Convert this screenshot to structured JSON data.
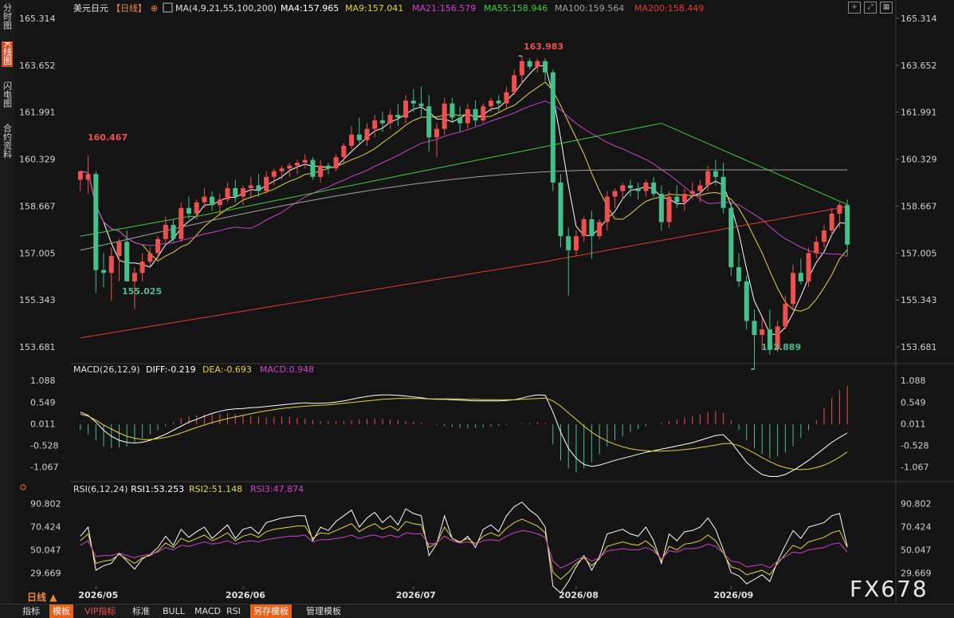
{
  "leftbar": {
    "tabs": [
      {
        "label": "分时图",
        "active": false
      },
      {
        "label": "K线图",
        "active": true
      },
      {
        "label": "闪电图",
        "active": false
      },
      {
        "label": "合约资料",
        "active": false
      }
    ]
  },
  "header": {
    "symbol": "美元日元",
    "period": "【日线】",
    "ma_title": "MA(4,9,21,55,100,200)",
    "ma4": "MA4:157.965",
    "ma9": "MA9:157.041",
    "ma21": "MA21:156.579",
    "ma55": "MA55:158.946",
    "ma100": "MA100:159.564",
    "ma200": "MA200:158.449"
  },
  "macd_header": {
    "title": "MACD(26,12,9)",
    "diff": "DIFF:-0.219",
    "dea": "DEA:-0.693",
    "macd": "MACD:0.948"
  },
  "rsi_header": {
    "title": "RSI(6,12,24)",
    "rsi1": "RSI1:53.253",
    "rsi2": "RSI2:51.148",
    "rsi3": "RSI3:47.874"
  },
  "price_axis": [
    "165.314",
    "163.652",
    "161.991",
    "160.329",
    "158.667",
    "157.005",
    "155.343",
    "153.681"
  ],
  "macd_axis": [
    "1.088",
    "0.549",
    "0.011",
    "-0.528",
    "-1.067"
  ],
  "rsi_axis": [
    "90.802",
    "70.424",
    "50.047",
    "29.669"
  ],
  "date_labels": [
    "2026/05",
    "2026/06",
    "2026/07",
    "2026/08",
    "2026/09"
  ],
  "annotations": {
    "high": "163.983",
    "first_high": "160.467",
    "first_low": "155.025",
    "low": "152.889"
  },
  "watermark": "FX678",
  "bottom_tabs": [
    {
      "label": "指标",
      "active": false
    },
    {
      "label": "模板",
      "active": true
    },
    {
      "label": "VIP指标",
      "active": false
    },
    {
      "label": "标准",
      "active": false
    },
    {
      "label": "BULL",
      "active": false
    },
    {
      "label": "MACD",
      "active": false
    },
    {
      "label": "RSI",
      "active": false
    },
    {
      "label": "另存模板",
      "active": true
    },
    {
      "label": "管理模板",
      "active": false
    }
  ],
  "bottom_period": "日线",
  "colors": {
    "up": "#ef4f4f",
    "down": "#46c08a",
    "ma4": "#ffffff",
    "ma9": "#e6d43a",
    "ma21": "#d040d0",
    "ma55": "#3ccf3c",
    "ma100": "#a0a0a0",
    "ma200": "#e83a2c",
    "diff": "#ffffff",
    "dea": "#e6d43a",
    "rsi1": "#ffffff",
    "rsi2": "#e6d43a",
    "rsi3": "#d040d0"
  },
  "chart_data": [
    {
      "type": "candlestick",
      "symbol": "美元日元",
      "period": "日线",
      "x_label_start": "2026/05",
      "ylim": [
        153.2,
        165.4
      ],
      "candles": [
        [
          159.6,
          159.8,
          159.2,
          159.9
        ],
        [
          159.6,
          160.467,
          159.1,
          159.8
        ],
        [
          159.8,
          159.9,
          155.6,
          156.4
        ],
        [
          156.4,
          157.0,
          155.8,
          156.3
        ],
        [
          156.3,
          157.2,
          155.3,
          156.9
        ],
        [
          156.9,
          157.5,
          156.0,
          157.4
        ],
        [
          157.4,
          157.8,
          156.5,
          156.0
        ],
        [
          156.0,
          156.5,
          155.025,
          156.3
        ],
        [
          156.3,
          157.0,
          156.0,
          156.7
        ],
        [
          156.7,
          157.2,
          156.5,
          157.0
        ],
        [
          157.0,
          157.6,
          156.8,
          157.5
        ],
        [
          157.5,
          158.3,
          157.4,
          158.0
        ],
        [
          158.0,
          158.2,
          157.4,
          157.5
        ],
        [
          157.5,
          158.8,
          157.4,
          158.6
        ],
        [
          158.6,
          159.0,
          158.2,
          158.4
        ],
        [
          158.4,
          158.9,
          158.2,
          158.8
        ],
        [
          158.8,
          159.3,
          158.6,
          159.0
        ],
        [
          159.0,
          159.2,
          158.5,
          158.7
        ],
        [
          158.7,
          159.1,
          158.4,
          158.9
        ],
        [
          158.9,
          159.5,
          158.8,
          159.3
        ],
        [
          159.3,
          159.6,
          158.8,
          159.0
        ],
        [
          159.0,
          159.4,
          158.7,
          159.3
        ],
        [
          159.3,
          159.7,
          159.0,
          159.4
        ],
        [
          159.4,
          159.8,
          159.0,
          159.2
        ],
        [
          159.2,
          159.9,
          159.1,
          159.7
        ],
        [
          159.7,
          160.0,
          159.4,
          159.9
        ],
        [
          159.9,
          160.1,
          159.6,
          160.0
        ],
        [
          160.0,
          160.2,
          159.7,
          160.1
        ],
        [
          160.1,
          160.3,
          159.8,
          160.2
        ],
        [
          160.2,
          160.5,
          160.0,
          160.3
        ],
        [
          160.3,
          160.4,
          159.6,
          159.7
        ],
        [
          159.7,
          160.3,
          159.5,
          160.1
        ],
        [
          160.1,
          160.2,
          159.8,
          160.0
        ],
        [
          160.0,
          160.5,
          159.9,
          160.4
        ],
        [
          160.4,
          160.9,
          160.2,
          160.8
        ],
        [
          160.8,
          161.5,
          160.7,
          161.2
        ],
        [
          161.2,
          161.8,
          160.9,
          161.0
        ],
        [
          161.0,
          161.6,
          160.8,
          161.4
        ],
        [
          161.4,
          161.9,
          161.1,
          161.7
        ],
        [
          161.7,
          162.0,
          161.3,
          161.6
        ],
        [
          161.6,
          162.1,
          161.4,
          161.9
        ],
        [
          161.9,
          162.3,
          161.5,
          161.8
        ],
        [
          161.8,
          162.6,
          161.6,
          162.4
        ],
        [
          162.4,
          162.8,
          162.0,
          162.3
        ],
        [
          162.3,
          162.9,
          161.8,
          162.2
        ],
        [
          162.2,
          162.6,
          160.6,
          161.1
        ],
        [
          161.1,
          161.6,
          160.4,
          161.4
        ],
        [
          161.4,
          162.5,
          161.2,
          162.3
        ],
        [
          162.3,
          162.5,
          161.6,
          161.8
        ],
        [
          161.8,
          162.2,
          161.3,
          161.6
        ],
        [
          161.6,
          162.3,
          161.4,
          162.1
        ],
        [
          162.1,
          162.4,
          161.5,
          161.7
        ],
        [
          161.7,
          162.3,
          161.6,
          162.2
        ],
        [
          162.2,
          162.5,
          162.0,
          162.4
        ],
        [
          162.4,
          162.6,
          162.0,
          162.3
        ],
        [
          162.3,
          162.9,
          162.1,
          162.7
        ],
        [
          162.7,
          163.5,
          162.6,
          163.3
        ],
        [
          163.3,
          163.983,
          163.0,
          163.8
        ],
        [
          163.8,
          163.9,
          163.5,
          163.6
        ],
        [
          163.6,
          163.9,
          163.4,
          163.8
        ],
        [
          163.8,
          163.9,
          163.1,
          163.4
        ],
        [
          163.4,
          163.5,
          159.2,
          159.5
        ],
        [
          159.5,
          159.8,
          157.2,
          157.6
        ],
        [
          157.6,
          157.9,
          155.5,
          157.1
        ],
        [
          157.1,
          157.8,
          156.9,
          157.6
        ],
        [
          157.6,
          158.3,
          157.4,
          158.2
        ],
        [
          158.2,
          158.5,
          156.8,
          157.6
        ],
        [
          157.6,
          158.2,
          157.5,
          158.1
        ],
        [
          158.1,
          159.2,
          157.8,
          159.0
        ],
        [
          159.0,
          159.3,
          158.6,
          159.2
        ],
        [
          159.2,
          159.5,
          158.9,
          159.4
        ],
        [
          159.4,
          159.6,
          159.0,
          159.3
        ],
        [
          159.3,
          159.5,
          158.9,
          159.2
        ],
        [
          159.2,
          159.6,
          159.0,
          159.5
        ],
        [
          159.5,
          159.7,
          159.0,
          159.1
        ],
        [
          159.1,
          159.4,
          157.8,
          158.1
        ],
        [
          158.1,
          159.2,
          157.9,
          159.0
        ],
        [
          159.0,
          159.4,
          158.6,
          158.8
        ],
        [
          158.8,
          159.3,
          158.5,
          159.1
        ],
        [
          159.1,
          159.5,
          158.9,
          159.2
        ],
        [
          159.2,
          159.6,
          158.8,
          159.4
        ],
        [
          159.4,
          160.1,
          159.2,
          159.9
        ],
        [
          159.9,
          160.3,
          159.4,
          159.7
        ],
        [
          159.7,
          160.2,
          158.4,
          158.6
        ],
        [
          158.6,
          158.8,
          156.2,
          156.5
        ],
        [
          156.5,
          157.0,
          155.8,
          156.0
        ],
        [
          156.0,
          156.2,
          154.3,
          154.6
        ],
        [
          154.6,
          155.0,
          152.889,
          154.1
        ],
        [
          154.1,
          154.7,
          153.6,
          154.3
        ],
        [
          154.3,
          155.0,
          153.4,
          153.6
        ],
        [
          153.6,
          154.6,
          153.5,
          154.4
        ],
        [
          154.4,
          155.5,
          154.3,
          155.2
        ],
        [
          155.2,
          156.6,
          155.0,
          156.3
        ],
        [
          156.3,
          156.8,
          155.9,
          156.0
        ],
        [
          156.0,
          157.2,
          155.8,
          157.0
        ],
        [
          157.0,
          157.6,
          156.8,
          157.4
        ],
        [
          157.4,
          158.0,
          157.2,
          157.8
        ],
        [
          157.8,
          158.6,
          157.6,
          158.4
        ],
        [
          158.4,
          158.8,
          157.9,
          158.7
        ],
        [
          158.7,
          158.9,
          156.9,
          157.3
        ]
      ],
      "high_label": 163.983,
      "low_label": 152.889,
      "first_high_label": 160.467,
      "first_low_label": 155.025
    },
    {
      "type": "bar",
      "name": "MACD(26,12,9)",
      "ylim": [
        -1.35,
        1.15
      ],
      "macd_bars": [
        -0.15,
        -0.25,
        -0.4,
        -0.55,
        -0.6,
        -0.58,
        -0.55,
        -0.45,
        -0.35,
        -0.25,
        -0.15,
        -0.05,
        0.05,
        0.15,
        0.2,
        0.22,
        0.24,
        0.25,
        0.26,
        0.27,
        0.25,
        0.22,
        0.2,
        0.18,
        0.17,
        0.18,
        0.19,
        0.18,
        0.16,
        0.14,
        0.1,
        0.08,
        0.07,
        0.07,
        0.08,
        0.1,
        0.12,
        0.13,
        0.14,
        0.13,
        0.12,
        0.1,
        0.08,
        0.06,
        0.04,
        0.02,
        -0.02,
        -0.05,
        -0.07,
        -0.09,
        -0.1,
        -0.09,
        -0.08,
        -0.06,
        -0.04,
        -0.02,
        0.0,
        0.02,
        0.03,
        0.05,
        0.03,
        -0.5,
        -0.9,
        -1.1,
        -1.2,
        -1.1,
        -0.95,
        -0.75,
        -0.55,
        -0.4,
        -0.3,
        -0.2,
        -0.12,
        -0.05,
        0.0,
        0.04,
        0.08,
        0.12,
        0.16,
        0.2,
        0.25,
        0.3,
        0.33,
        0.28,
        0.1,
        -0.15,
        -0.4,
        -0.6,
        -0.75,
        -0.85,
        -0.8,
        -0.7,
        -0.55,
        -0.35,
        -0.15,
        0.1,
        0.4,
        0.65,
        0.85,
        0.95
      ],
      "diff": [
        0.3,
        0.22,
        0.05,
        -0.15,
        -0.3,
        -0.4,
        -0.45,
        -0.47,
        -0.45,
        -0.4,
        -0.33,
        -0.25,
        -0.15,
        -0.05,
        0.05,
        0.12,
        0.2,
        0.27,
        0.32,
        0.36,
        0.38,
        0.39,
        0.41,
        0.42,
        0.44,
        0.46,
        0.48,
        0.5,
        0.52,
        0.53,
        0.52,
        0.52,
        0.53,
        0.55,
        0.58,
        0.62,
        0.66,
        0.69,
        0.72,
        0.73,
        0.73,
        0.72,
        0.7,
        0.68,
        0.66,
        0.63,
        0.62,
        0.62,
        0.61,
        0.6,
        0.59,
        0.58,
        0.58,
        0.58,
        0.58,
        0.59,
        0.61,
        0.65,
        0.7,
        0.73,
        0.72,
        0.3,
        -0.2,
        -0.6,
        -0.85,
        -1.0,
        -1.05,
        -1.02,
        -0.96,
        -0.9,
        -0.85,
        -0.8,
        -0.75,
        -0.7,
        -0.66,
        -0.62,
        -0.58,
        -0.54,
        -0.5,
        -0.46,
        -0.4,
        -0.34,
        -0.28,
        -0.26,
        -0.45,
        -0.7,
        -0.95,
        -1.12,
        -1.25,
        -1.3,
        -1.3,
        -1.25,
        -1.15,
        -1.03,
        -0.9,
        -0.75,
        -0.6,
        -0.45,
        -0.33,
        -0.22
      ],
      "dea": [
        0.25,
        0.2,
        0.1,
        -0.02,
        -0.12,
        -0.22,
        -0.3,
        -0.35,
        -0.38,
        -0.38,
        -0.36,
        -0.33,
        -0.28,
        -0.22,
        -0.15,
        -0.08,
        -0.02,
        0.04,
        0.09,
        0.14,
        0.18,
        0.22,
        0.26,
        0.3,
        0.33,
        0.36,
        0.39,
        0.41,
        0.43,
        0.45,
        0.46,
        0.47,
        0.48,
        0.5,
        0.52,
        0.54,
        0.56,
        0.58,
        0.6,
        0.62,
        0.63,
        0.64,
        0.64,
        0.64,
        0.64,
        0.63,
        0.63,
        0.63,
        0.63,
        0.63,
        0.62,
        0.62,
        0.61,
        0.61,
        0.61,
        0.61,
        0.61,
        0.62,
        0.63,
        0.64,
        0.65,
        0.58,
        0.45,
        0.28,
        0.12,
        -0.05,
        -0.2,
        -0.32,
        -0.42,
        -0.5,
        -0.56,
        -0.61,
        -0.64,
        -0.66,
        -0.67,
        -0.67,
        -0.66,
        -0.65,
        -0.63,
        -0.61,
        -0.58,
        -0.55,
        -0.52,
        -0.48,
        -0.48,
        -0.53,
        -0.62,
        -0.72,
        -0.83,
        -0.93,
        -1.02,
        -1.08,
        -1.12,
        -1.13,
        -1.12,
        -1.08,
        -1.02,
        -0.93,
        -0.82,
        -0.69
      ]
    },
    {
      "type": "line",
      "name": "RSI(6,12,24)",
      "ylim": [
        18,
        96
      ],
      "rsi1": [
        62,
        70,
        32,
        36,
        38,
        47,
        40,
        33,
        42,
        46,
        52,
        62,
        54,
        68,
        61,
        66,
        70,
        60,
        66,
        72,
        60,
        68,
        70,
        64,
        74,
        76,
        78,
        79,
        80,
        80,
        58,
        70,
        67,
        75,
        80,
        85,
        70,
        78,
        83,
        74,
        80,
        72,
        86,
        82,
        80,
        45,
        55,
        80,
        60,
        56,
        62,
        52,
        68,
        72,
        66,
        80,
        88,
        92,
        85,
        80,
        70,
        18,
        12,
        22,
        35,
        45,
        32,
        44,
        64,
        66,
        68,
        64,
        62,
        70,
        58,
        38,
        64,
        58,
        66,
        67,
        70,
        78,
        68,
        50,
        30,
        27,
        20,
        24,
        28,
        22,
        40,
        54,
        67,
        60,
        70,
        72,
        74,
        80,
        82,
        53
      ],
      "rsi2": [
        58,
        64,
        38,
        40,
        41,
        46,
        42,
        38,
        43,
        45,
        49,
        56,
        52,
        60,
        57,
        60,
        63,
        58,
        61,
        65,
        58,
        62,
        64,
        61,
        66,
        68,
        69,
        70,
        71,
        71,
        60,
        65,
        64,
        67,
        70,
        73,
        66,
        70,
        73,
        68,
        71,
        67,
        75,
        73,
        72,
        52,
        56,
        70,
        60,
        57,
        60,
        55,
        62,
        65,
        62,
        69,
        74,
        77,
        74,
        71,
        65,
        30,
        24,
        30,
        38,
        43,
        36,
        42,
        53,
        55,
        57,
        55,
        54,
        58,
        52,
        40,
        53,
        50,
        55,
        56,
        58,
        63,
        58,
        47,
        35,
        33,
        28,
        30,
        32,
        28,
        38,
        46,
        54,
        51,
        57,
        59,
        61,
        65,
        67,
        52
      ],
      "rsi3": [
        54,
        58,
        44,
        45,
        45,
        47,
        45,
        43,
        45,
        46,
        48,
        52,
        50,
        54,
        53,
        55,
        57,
        55,
        56,
        58,
        55,
        57,
        58,
        57,
        59,
        60,
        61,
        62,
        62,
        63,
        57,
        59,
        59,
        60,
        61,
        63,
        60,
        62,
        63,
        61,
        63,
        61,
        65,
        64,
        64,
        55,
        56,
        62,
        58,
        56,
        57,
        55,
        58,
        59,
        58,
        62,
        65,
        67,
        66,
        64,
        61,
        40,
        34,
        37,
        41,
        44,
        40,
        43,
        49,
        50,
        51,
        50,
        50,
        52,
        49,
        42,
        49,
        48,
        51,
        51,
        52,
        55,
        53,
        47,
        40,
        39,
        35,
        36,
        37,
        34,
        40,
        44,
        48,
        47,
        50,
        51,
        52,
        55,
        56,
        48
      ]
    }
  ]
}
